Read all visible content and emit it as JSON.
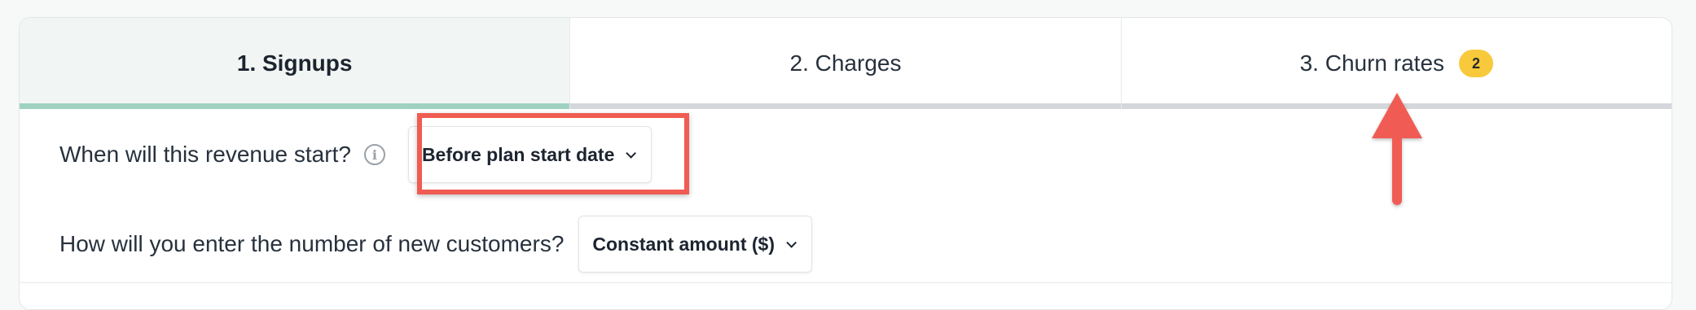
{
  "tabs": [
    {
      "label": "1. Signups",
      "active": true
    },
    {
      "label": "2. Charges",
      "active": false
    },
    {
      "label": "3. Churn rates",
      "active": false,
      "badge": "2"
    }
  ],
  "fields": {
    "revenue_start": {
      "label": "When will this revenue start?",
      "icon": "info-icon",
      "value": "Before plan start date"
    },
    "new_customers": {
      "label": "How will you enter the number of new customers?",
      "value": "Constant amount ($)"
    }
  },
  "annotations": {
    "highlight_color": "#f05b52",
    "arrow_color": "#f05b52"
  },
  "colors": {
    "active_tab_bg": "#f1f6f4",
    "active_tab_bar": "#9fd1c1",
    "inactive_tab_bar": "#d4d8dc",
    "badge_bg": "#f8c93a"
  }
}
